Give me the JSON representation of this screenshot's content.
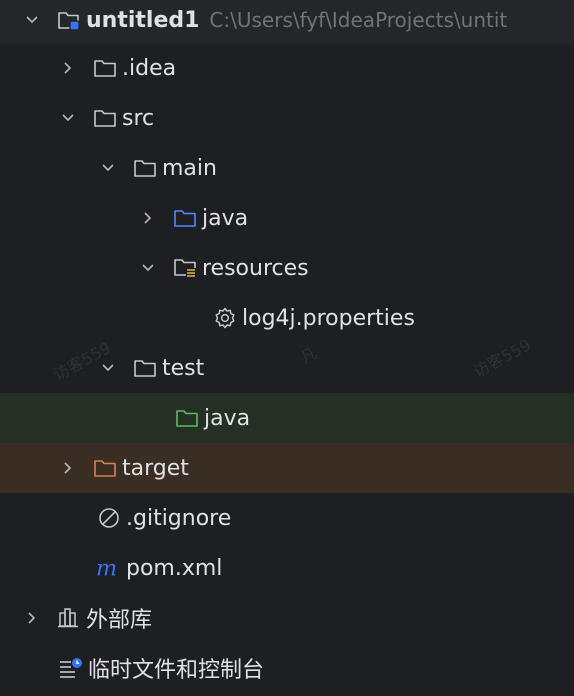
{
  "project": {
    "name": "untitled1",
    "path": "C:\\Users\\fyf\\IdeaProjects\\untit"
  },
  "items": {
    "idea": ".idea",
    "src": "src",
    "main": "main",
    "main_java": "java",
    "resources": "resources",
    "log4j": "log4j.properties",
    "test": "test",
    "test_java": "java",
    "target": "target",
    "gitignore": ".gitignore",
    "pom": "pom.xml",
    "external_libs": "外部库",
    "scratches": "临时文件和控制台"
  },
  "watermark": {
    "left": "访客559",
    "middle": "凡",
    "right": "访客559"
  },
  "colors": {
    "folder": "#c5c8ce",
    "source_folder": "#548af7",
    "test_folder": "#5fb865",
    "excluded_folder": "#d9824c",
    "maven": "#3574f0",
    "selected_test_row": "#253025",
    "excluded_row": "#3a2d24"
  }
}
